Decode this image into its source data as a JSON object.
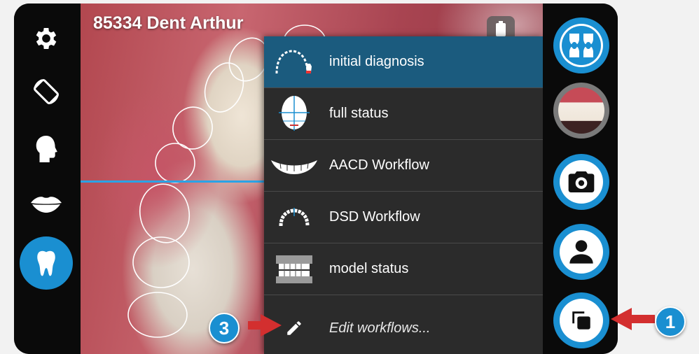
{
  "patient": {
    "name": "85334 Dent Arthur"
  },
  "workflow_menu": {
    "items": [
      {
        "label": "initial diagnosis",
        "icon": "arch-with-tooth-icon",
        "selected": true
      },
      {
        "label": "full status",
        "icon": "head-grid-icon",
        "selected": false
      },
      {
        "label": "AACD Workflow",
        "icon": "smile-teeth-icon",
        "selected": false
      },
      {
        "label": "DSD Workflow",
        "icon": "arch-icon",
        "selected": false
      },
      {
        "label": "model status",
        "icon": "dental-model-icon",
        "selected": false
      },
      {
        "label": "Edit workflows...",
        "icon": "pencil-icon",
        "selected": false
      }
    ]
  },
  "left_toolbar": [
    "gear-icon",
    "rotate-screen-icon",
    "head-profile-icon",
    "lips-icon",
    "tooth-icon"
  ],
  "right_toolbar": [
    "teeth-grid-icon",
    "smile-photo-thumbnail",
    "camera-icon",
    "person-icon",
    "workflows-icon"
  ],
  "annotations": {
    "callout_1": "1",
    "callout_3": "3"
  },
  "colors": {
    "accent": "#1a8fd1",
    "menu_bg": "#2b2b2b",
    "selected_bg": "#1b5b7e",
    "arrow": "#d32f2f"
  }
}
